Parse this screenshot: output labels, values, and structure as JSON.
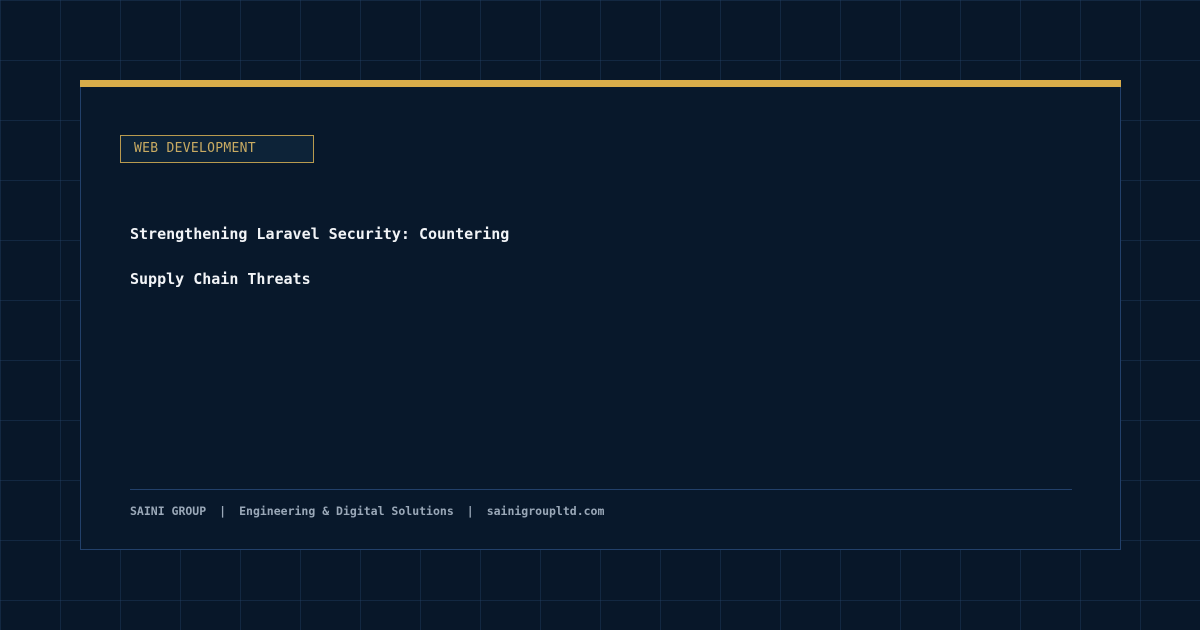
{
  "category": "WEB DEVELOPMENT",
  "title_lines": [
    "Strengthening Laravel Security: Countering",
    "Supply Chain Threats"
  ],
  "footer": {
    "company": "SAINI GROUP",
    "separator": "|",
    "tagline": "Engineering & Digital Solutions",
    "website": "sainigroupltd.com"
  },
  "colors": {
    "background": "#081729",
    "card": "#08182b",
    "accent": "#d9ad4a",
    "title_text": "#f2f4f7",
    "footer_text": "#9aa8b8",
    "tag_text": "#c9ab62"
  }
}
